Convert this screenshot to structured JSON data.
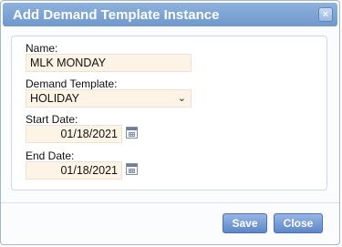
{
  "dialog": {
    "title": "Add Demand Template Instance",
    "close_icon": "×",
    "fields": {
      "name_label": "Name:",
      "name_value": "MLK MONDAY",
      "template_label": "Demand Template:",
      "template_value": "HOLIDAY",
      "template_chevron": "⌄",
      "start_label": "Start Date:",
      "start_value": "01/18/2021",
      "end_label": "End Date:",
      "end_value": "01/18/2021"
    },
    "buttons": {
      "save": "Save",
      "close": "Close"
    }
  }
}
